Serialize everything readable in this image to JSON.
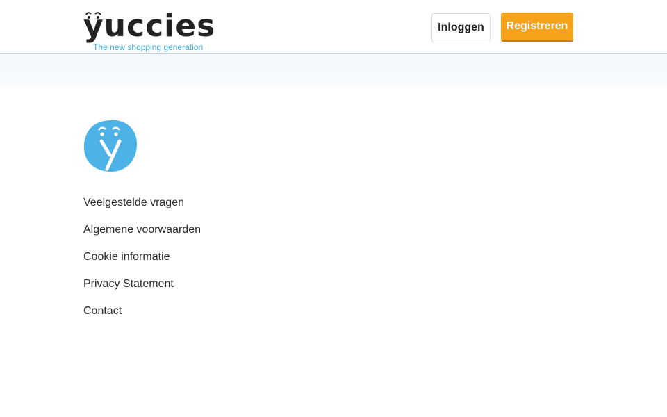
{
  "header": {
    "logo_text": "yuccies",
    "tagline": "The new shopping generation",
    "login_label": "Inloggen",
    "register_label": "Registreren"
  },
  "footer": {
    "links": [
      "Veelgestelde vragen",
      "Algemene voorwaarden",
      "Cookie informatie",
      "Privacy Statement",
      "Contact"
    ]
  },
  "colors": {
    "accent_orange": "#f7a21b",
    "brand_blue": "#3aaee0",
    "text_dark": "#222222"
  },
  "icons": {
    "brand_icon": "yuccies-y-icon"
  }
}
